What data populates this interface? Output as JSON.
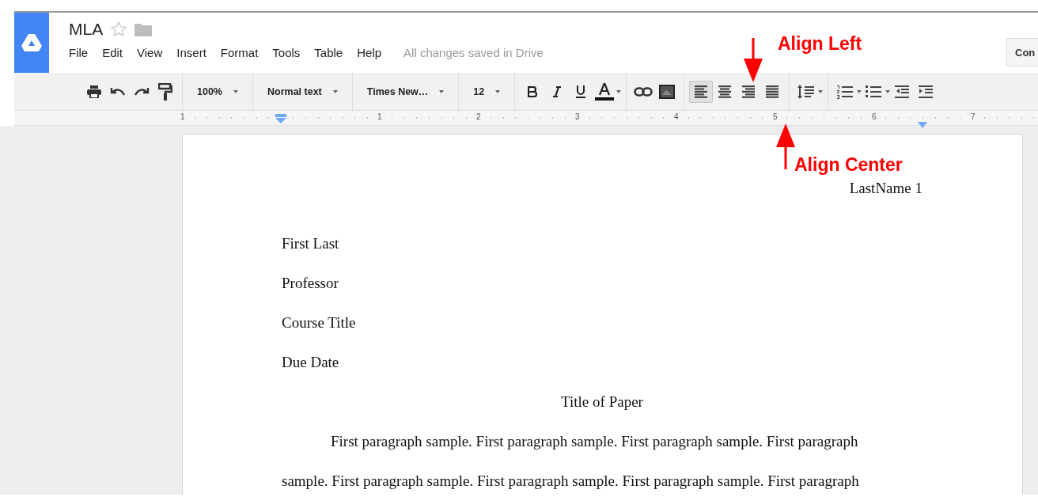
{
  "document": {
    "title": "MLA",
    "starred": false
  },
  "menu": [
    "File",
    "Edit",
    "View",
    "Insert",
    "Format",
    "Tools",
    "Table",
    "Help"
  ],
  "save_status": "All changes saved in Drive",
  "share_button": "Con",
  "toolbar": {
    "zoom": "100%",
    "style": "Normal text",
    "font": "Times New…",
    "size": "12",
    "alignment": [
      {
        "selected": true
      },
      {
        "selected": false
      },
      {
        "selected": false
      },
      {
        "selected": false
      }
    ]
  },
  "ruler": [
    "1",
    "1",
    "2",
    "3",
    "4",
    "5",
    "6",
    "7"
  ],
  "page": {
    "header": "LastName 1",
    "lines": [
      {
        "text": "First Last",
        "kind": "left"
      },
      {
        "text": "Professor",
        "kind": "left"
      },
      {
        "text": "Course Title",
        "kind": "left"
      },
      {
        "text": "Due Date",
        "kind": "left"
      },
      {
        "text": "Title of Paper",
        "kind": "center"
      },
      {
        "text": "First paragraph sample. First paragraph sample. First paragraph sample. First paragraph",
        "kind": "indent"
      },
      {
        "text": "sample. First paragraph sample. First paragraph sample. First paragraph sample. First paragraph",
        "kind": "left"
      }
    ]
  },
  "annotations": [
    {
      "text": "Align Left",
      "kind": "down"
    },
    {
      "text": "Align Center",
      "kind": "up"
    }
  ]
}
